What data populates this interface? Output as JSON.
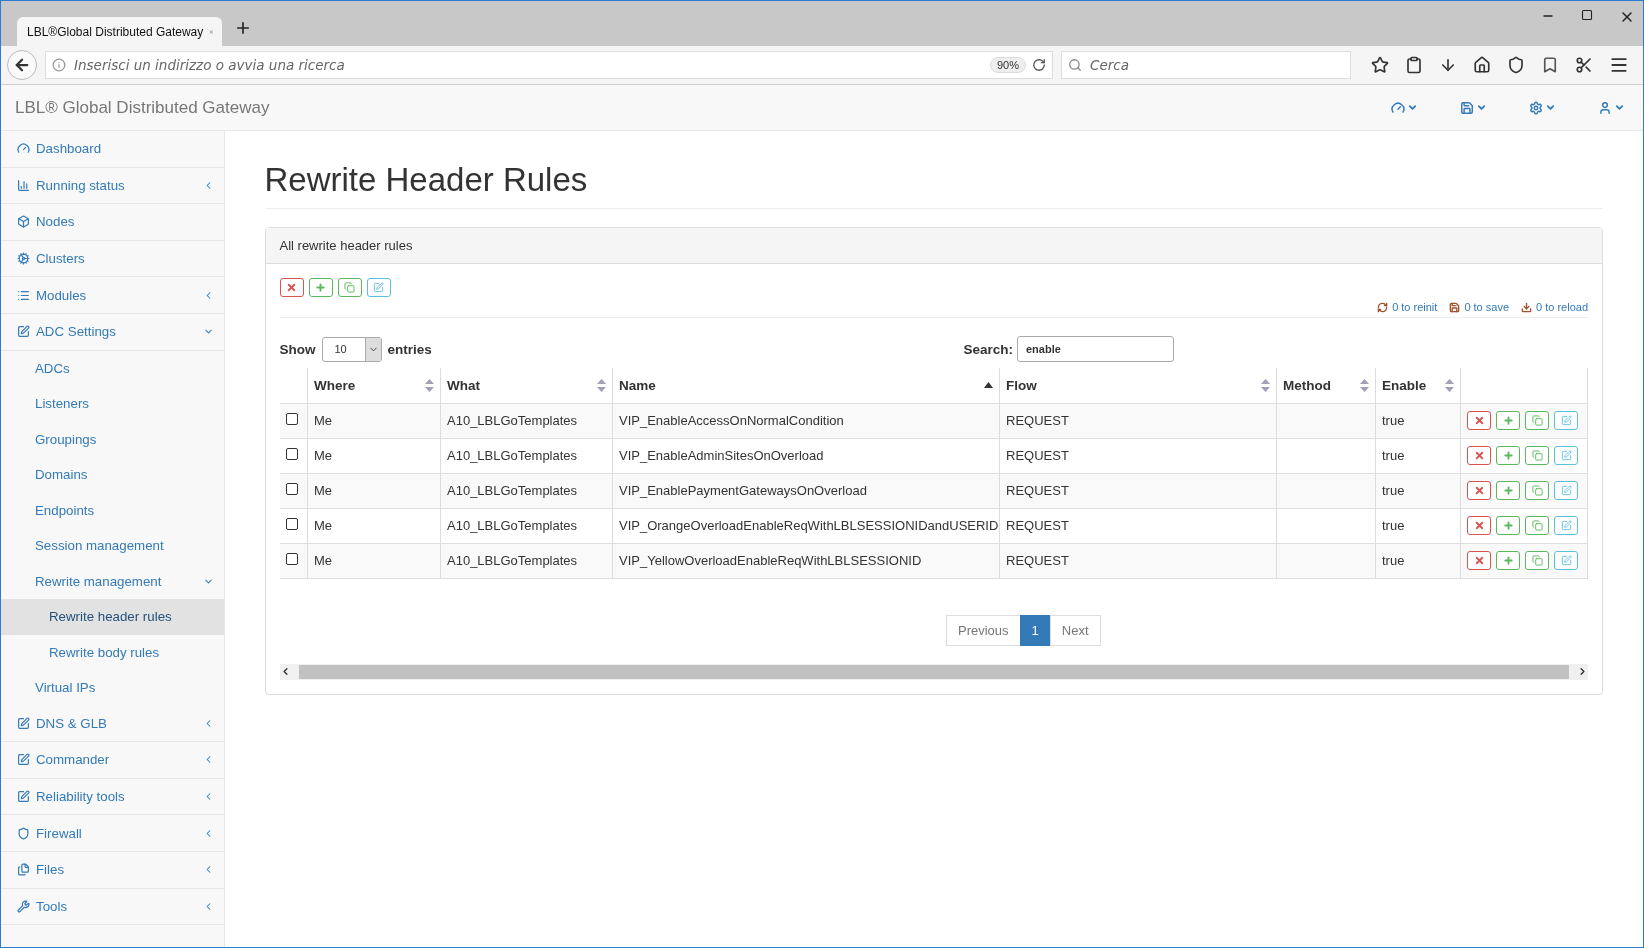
{
  "browser": {
    "tab_title": "LBL®Global Distributed Gateway",
    "address_placeholder": "Inserisci un indirizzo o avvia una ricerca",
    "zoom": "90%",
    "search_placeholder": "Cerca"
  },
  "app": {
    "brand": "LBL® Global Distributed Gateway"
  },
  "sidebar": {
    "items": [
      {
        "label": "Dashboard",
        "selected": false
      },
      {
        "label": "Running status",
        "selected": false,
        "expanded": false
      },
      {
        "label": "Nodes",
        "selected": false
      },
      {
        "label": "Clusters",
        "selected": false
      },
      {
        "label": "Modules",
        "selected": false,
        "expanded": false
      },
      {
        "label": "ADC Settings",
        "selected": false,
        "expanded": true,
        "children": [
          {
            "label": "ADCs",
            "selected": false
          },
          {
            "label": "Listeners",
            "selected": false
          },
          {
            "label": "Groupings",
            "selected": false
          },
          {
            "label": "Domains",
            "selected": false
          },
          {
            "label": "Endpoints",
            "selected": false
          },
          {
            "label": "Session management",
            "selected": false
          },
          {
            "label": "Rewrite management",
            "selected": false,
            "expanded": true,
            "children": [
              {
                "label": "Rewrite header rules",
                "selected": true
              },
              {
                "label": "Rewrite body rules",
                "selected": false
              }
            ]
          },
          {
            "label": "Virtual IPs",
            "selected": false
          }
        ]
      },
      {
        "label": "DNS & GLB",
        "selected": false,
        "expanded": false
      },
      {
        "label": "Commander",
        "selected": false,
        "expanded": false
      },
      {
        "label": "Reliability tools",
        "selected": false,
        "expanded": false
      },
      {
        "label": "Firewall",
        "selected": false,
        "expanded": false
      },
      {
        "label": "Files",
        "selected": false,
        "expanded": false
      },
      {
        "label": "Tools",
        "selected": false,
        "expanded": false
      }
    ]
  },
  "page": {
    "title": "Rewrite Header Rules"
  },
  "panel": {
    "title": "All rewrite header rules",
    "status_links": [
      "0 to reinit",
      "0 to save",
      "0 to reload"
    ],
    "length": {
      "label_before": "Show",
      "value": "10",
      "label_after": "entries"
    },
    "search": {
      "label": "Search:",
      "value": "enable"
    },
    "table": {
      "columns": [
        {
          "label": "Where",
          "sorted": false
        },
        {
          "label": "What",
          "sorted": false
        },
        {
          "label": "Name",
          "sorted": true
        },
        {
          "label": "Flow",
          "sorted": false
        },
        {
          "label": "Method",
          "sorted": false
        },
        {
          "label": "Enable",
          "sorted": false
        }
      ],
      "rows": [
        {
          "checked": false,
          "cells": [
            "Me",
            "A10_LBLGoTemplates",
            "VIP_EnableAccessOnNormalCondition",
            "REQUEST",
            "",
            "true"
          ]
        },
        {
          "checked": false,
          "cells": [
            "Me",
            "A10_LBLGoTemplates",
            "VIP_EnableAdminSitesOnOverload",
            "REQUEST",
            "",
            "true"
          ]
        },
        {
          "checked": false,
          "cells": [
            "Me",
            "A10_LBLGoTemplates",
            "VIP_EnablePaymentGatewaysOnOverload",
            "REQUEST",
            "",
            "true"
          ]
        },
        {
          "checked": false,
          "cells": [
            "Me",
            "A10_LBLGoTemplates",
            "VIP_OrangeOverloadEnableReqWithLBLSESSIONIDandUSERID",
            "REQUEST",
            "",
            "true"
          ]
        },
        {
          "checked": false,
          "cells": [
            "Me",
            "A10_LBLGoTemplates",
            "VIP_YellowOverloadEnableReqWithLBLSESSIONID",
            "REQUEST",
            "",
            "true"
          ]
        }
      ]
    },
    "pagination": {
      "previous": "Previous",
      "pages": [
        {
          "label": "1",
          "selected": true
        }
      ],
      "next": "Next"
    }
  }
}
